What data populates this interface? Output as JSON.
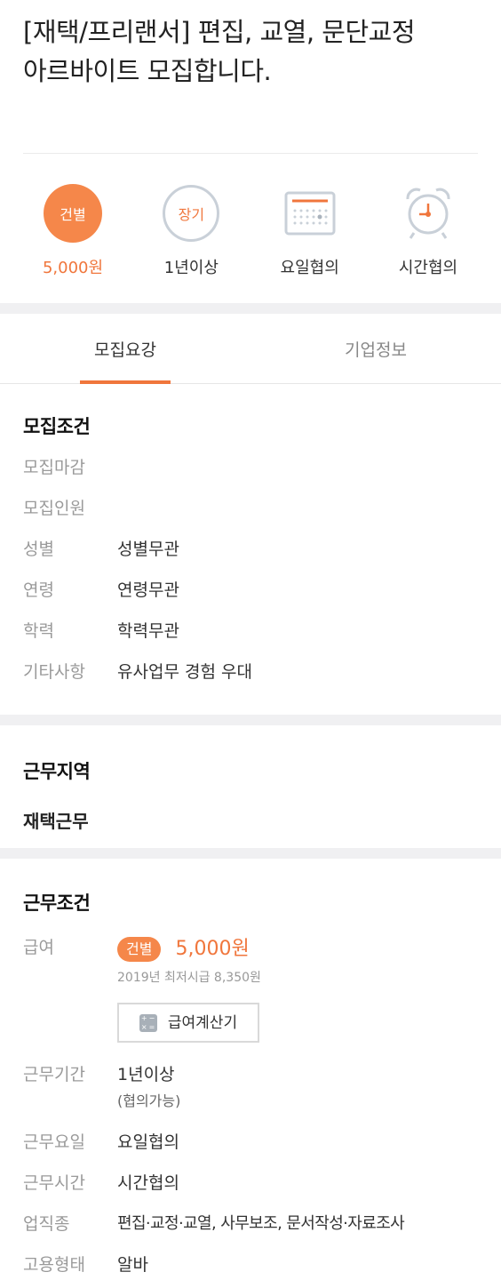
{
  "header": {
    "title_line1": "[재택/프리랜서] 편집, 교열, 문단교정",
    "title_line2": "아르바이트 모집합니다."
  },
  "summary": {
    "pay_type": "건별",
    "pay_amount": "5,000원",
    "period_badge": "장기",
    "period": "1년이상",
    "days": "요일협의",
    "hours": "시간협의"
  },
  "tabs": {
    "recruit": "모집요강",
    "company": "기업정보"
  },
  "recruit_conditions": {
    "title": "모집조건",
    "rows": [
      {
        "key": "모집마감",
        "value": ""
      },
      {
        "key": "모집인원",
        "value": ""
      },
      {
        "key": "성별",
        "value": "성별무관"
      },
      {
        "key": "연령",
        "value": "연령무관"
      },
      {
        "key": "학력",
        "value": "학력무관"
      },
      {
        "key": "기타사항",
        "value": "유사업무 경험 우대"
      }
    ]
  },
  "work_region": {
    "title": "근무지역",
    "value": "재택근무"
  },
  "work_conditions": {
    "title": "근무조건",
    "pay_key": "급여",
    "pay_badge": "건별",
    "pay_amount": "5,000원",
    "min_wage": "2019년 최저시급 8,350원",
    "calc_button": "급여계산기",
    "period_key": "근무기간",
    "period_value": "1년이상",
    "period_note": "(협의가능)",
    "days_key": "근무요일",
    "days_value": "요일협의",
    "hours_key": "근무시간",
    "hours_value": "시간협의",
    "job_key": "업직종",
    "job_value": "편집·교정·교열, 사무보조, 문서작성·자료조사",
    "type_key": "고용형태",
    "type_value": "알바"
  },
  "colors": {
    "accent": "#f0763c",
    "accent_fill": "#f5874a",
    "muted_label": "#9a9a9a",
    "section_gap": "#f0f0f2"
  },
  "icons": {
    "calendar": "calendar-icon",
    "alarm": "alarm-clock-icon",
    "calculator": "calculator-icon"
  }
}
